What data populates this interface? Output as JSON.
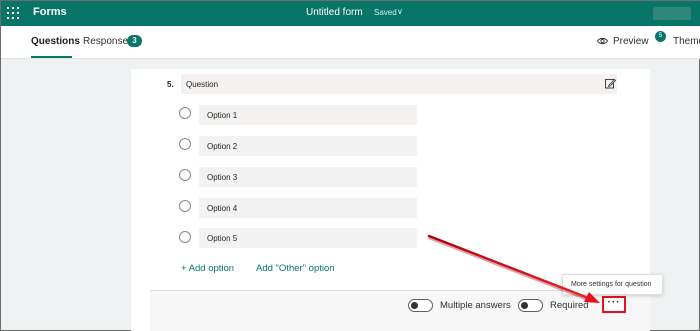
{
  "header": {
    "app_name": "Forms",
    "doc_title": "Untitled form",
    "doc_status": "Saved",
    "chevron": "∨"
  },
  "subnav": {
    "tab_questions": "Questions",
    "tab_responses": "Responses",
    "responses_count": "3",
    "preview_label": "Preview",
    "theme_label": "Theme",
    "theme_badge": "5"
  },
  "question": {
    "number": "5.",
    "title": "Question",
    "options": [
      "Option 1",
      "Option 2",
      "Option 3",
      "Option 4",
      "Option 5"
    ],
    "add_option": "+ Add option",
    "add_other": "Add \"Other\" option"
  },
  "footer": {
    "multiple_answers_label": "Multiple answers",
    "required_label": "Required",
    "more_button": "···",
    "tooltip": "More settings for question"
  },
  "colors": {
    "accent": "#077568",
    "highlight": "#e81123"
  },
  "icons": {
    "waffle": "app-launcher-icon",
    "eye": "eye-icon",
    "edit": "edit-icon",
    "theme": "palette-icon"
  }
}
